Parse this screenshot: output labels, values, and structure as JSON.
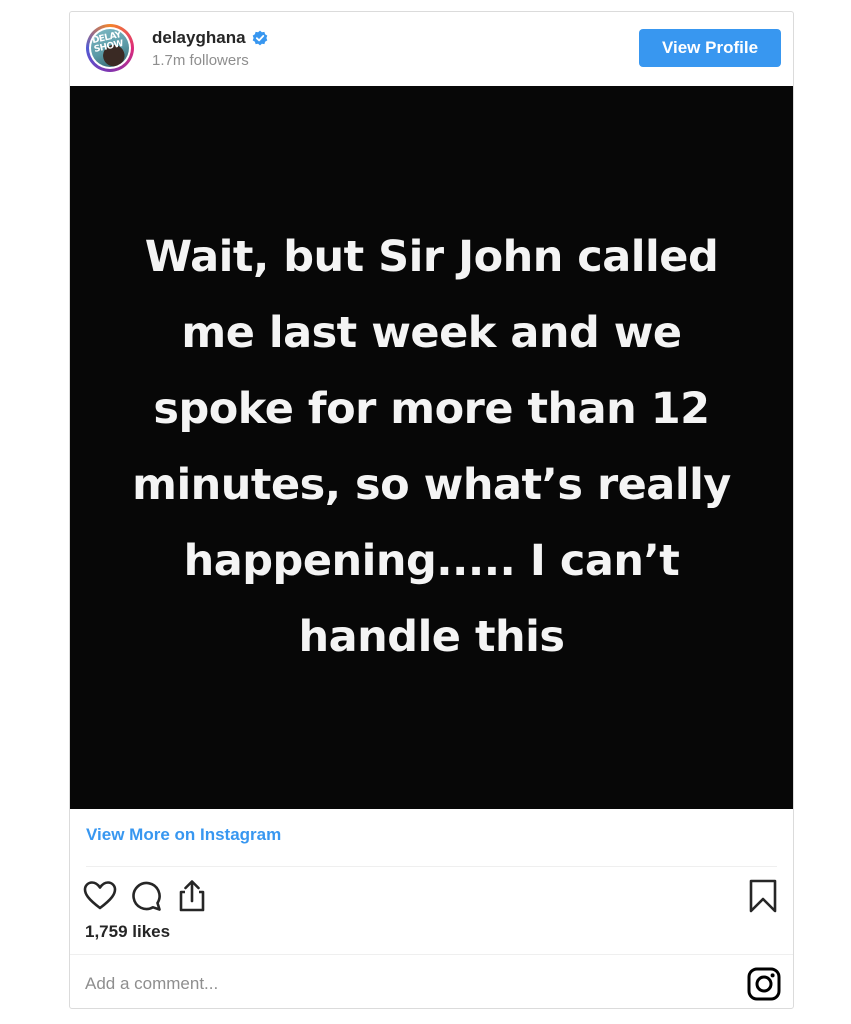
{
  "header": {
    "username": "delayghana",
    "followers": "1.7m followers",
    "view_profile_label": "View Profile",
    "avatar_logo_line1": "DELAY",
    "avatar_logo_line2": "SHOW",
    "verified_icon": "verified-badge-icon",
    "verified_color": "#3897f0"
  },
  "post": {
    "lines": [
      "Wait, but Sir John called",
      "me last week and we",
      "spoke for more than 12",
      "minutes, so what’s really",
      "happening..... I can’t",
      "handle this"
    ],
    "background": "#070707",
    "text_color": "#f4f4f4"
  },
  "footer": {
    "view_more_label": "View More on Instagram",
    "likes": "1,759 likes",
    "comment_placeholder": "Add a comment...",
    "icons": {
      "like": "heart-icon",
      "comment": "comment-bubble-icon",
      "share": "share-icon",
      "save": "bookmark-icon",
      "brand": "instagram-icon"
    },
    "link_color": "#3897f0"
  }
}
